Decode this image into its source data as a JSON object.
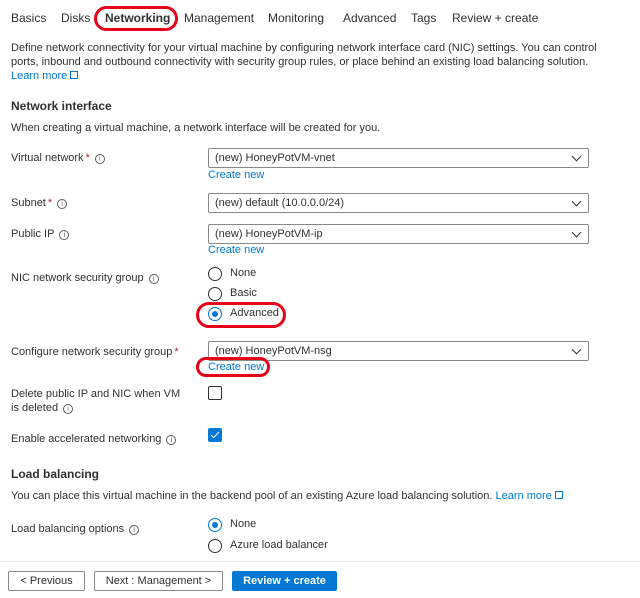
{
  "tabs": [
    {
      "label": "Basics"
    },
    {
      "label": "Disks"
    },
    {
      "label": "Networking"
    },
    {
      "label": "Management"
    },
    {
      "label": "Monitoring"
    },
    {
      "label": "Advanced"
    },
    {
      "label": "Tags"
    },
    {
      "label": "Review + create"
    }
  ],
  "active_tab": "Networking",
  "intro": {
    "text": "Define network connectivity for your virtual machine by configuring network interface card (NIC) settings. You can control ports, inbound and outbound connectivity with security group rules, or place behind an existing load balancing solution.",
    "learn_more": "Learn more"
  },
  "network_interface": {
    "title": "Network interface",
    "desc": "When creating a virtual machine, a network interface will be created for you.",
    "virtual_network": {
      "label": "Virtual network",
      "required": "*",
      "value": "(new) HoneyPotVM-vnet",
      "create_new": "Create new"
    },
    "subnet": {
      "label": "Subnet",
      "required": "*",
      "value": "(new) default (10.0.0.0/24)"
    },
    "public_ip": {
      "label": "Public IP",
      "value": "(new) HoneyPotVM-ip",
      "create_new": "Create new"
    },
    "nic_nsg": {
      "label": "NIC network security group",
      "options": [
        "None",
        "Basic",
        "Advanced"
      ],
      "selected": "Advanced"
    },
    "configure_nsg": {
      "label": "Configure network security group",
      "required": "*",
      "value": "(new) HoneyPotVM-nsg",
      "create_new": "Create new"
    },
    "delete_public_ip": {
      "label": "Delete public IP and NIC when VM is deleted",
      "checked": false
    },
    "accelerated_networking": {
      "label": "Enable accelerated networking",
      "checked": true
    }
  },
  "load_balancing": {
    "title": "Load balancing",
    "desc": "You can place this virtual machine in the backend pool of an existing Azure load balancing solution.",
    "learn_more": "Learn more",
    "options_label": "Load balancing options",
    "options": [
      "None",
      "Azure load balancer"
    ],
    "selected": "None"
  },
  "footer": {
    "previous": "< Previous",
    "next": "Next : Management >",
    "review": "Review + create"
  },
  "icons": {
    "info": "info-icon",
    "chevron": "chevron-down-icon",
    "external": "external-link-icon",
    "check": "checkmark-icon"
  },
  "colors": {
    "accent": "#0078d4",
    "highlight": "#e6001a",
    "required": "#a4262c"
  }
}
